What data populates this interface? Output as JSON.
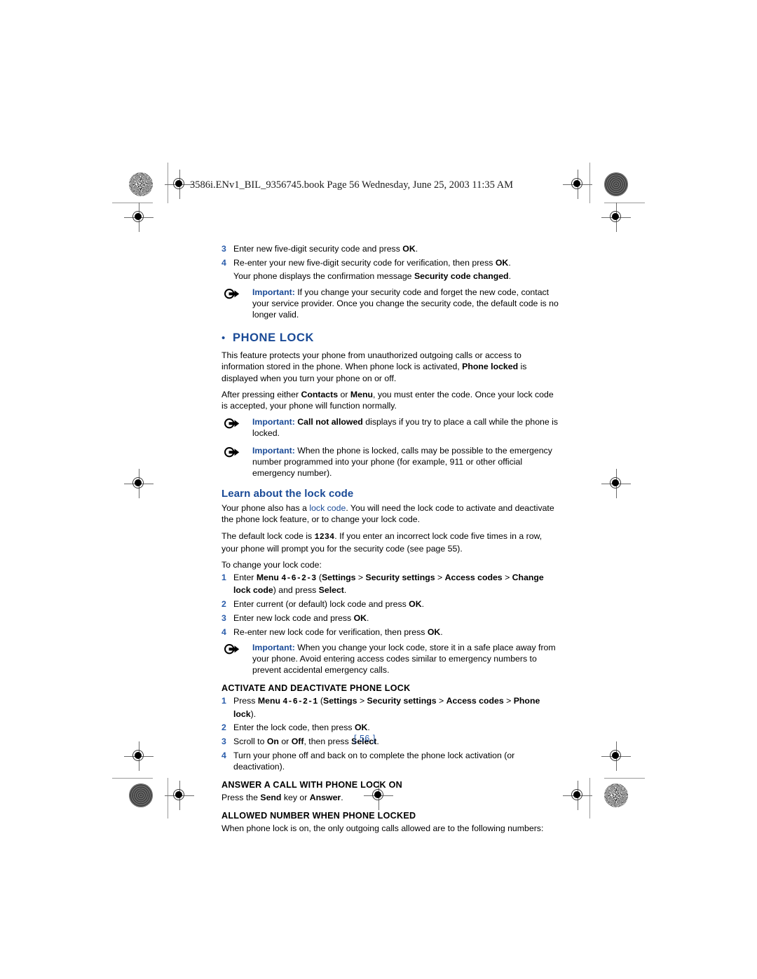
{
  "document": {
    "book_header": "3586i.ENv1_BIL_9356745.book  Page 56  Wednesday, June 25, 2003  11:35 AM",
    "page_number": "[ 56 ]"
  },
  "colors": {
    "heading_blue": "#1a4a96",
    "step_number_blue": "#2a5caa",
    "body_black": "#000000"
  },
  "top_steps": [
    {
      "num": "3",
      "text_pre": "Enter new five-digit security code and press ",
      "bold": "OK",
      "text_post": "."
    },
    {
      "num": "4",
      "text_pre": "Re-enter your new five-digit security code for verification, then press ",
      "bold": "OK",
      "text_post": "."
    }
  ],
  "top_steps_followup": {
    "text_pre": "Your phone displays the confirmation message ",
    "bold": "Security code changed",
    "text_post": "."
  },
  "important_1": {
    "label": "Important:",
    "text": " If you change your security code and forget the new code, contact your service provider. Once you change the security code, the default code is no longer valid.",
    "icon": "important-arrow-icon"
  },
  "phone_lock": {
    "bullet": "•",
    "heading": "PHONE LOCK",
    "para_1_a": "This feature protects your phone from unauthorized outgoing calls or access to information stored in the phone. When phone lock is activated, ",
    "para_1_bold": "Phone locked",
    "para_1_b": " is displayed when you turn your phone on or off.",
    "para_2_a": "After pressing either ",
    "para_2_bold_1": "Contacts",
    "para_2_b": " or ",
    "para_2_bold_2": "Menu",
    "para_2_c": ", you must enter the code. Once your lock code is accepted, your phone will function normally."
  },
  "important_2": {
    "label": "Important:",
    "text_a": " ",
    "bold": "Call not allowed",
    "text_b": " displays if you try to place a call while the phone is locked.",
    "icon": "important-arrow-icon"
  },
  "important_3": {
    "label": "Important:",
    "text": " When the phone is locked, calls may be possible to the emergency number programmed into your phone (for example, 911 or other official emergency number).",
    "icon": "important-arrow-icon"
  },
  "lock_code": {
    "heading": "Learn about the lock code",
    "para_1_a": "Your phone also has a ",
    "para_1_link": "lock code",
    "para_1_b": ". You will need the lock code to activate and deactivate the phone lock feature, or to change your lock code.",
    "para_2_a": "The default lock code is ",
    "para_2_mono": "1234",
    "para_2_b": ". If you enter an incorrect lock code five times in a row, your phone will prompt you for the security code (see page 55).",
    "para_3": "To change your lock code:",
    "steps": [
      {
        "num": "1",
        "pre": "Enter ",
        "menu_bold": "Menu ",
        "menu_mono": "4-6-2-3",
        "mid": " (",
        "b1": "Settings",
        "sep1": " > ",
        "b2": "Security settings",
        "sep2": " > ",
        "b3": "Access codes",
        "sep3": " > ",
        "b4": "Change lock code",
        "post": ") and press ",
        "b5": "Select",
        "end": "."
      },
      {
        "num": "2",
        "pre": "Enter current (or default) lock code and press ",
        "b1": "OK",
        "end": "."
      },
      {
        "num": "3",
        "pre": "Enter new lock code and press ",
        "b1": "OK",
        "end": "."
      },
      {
        "num": "4",
        "pre": "Re-enter new lock code for verification, then press ",
        "b1": "OK",
        "end": "."
      }
    ]
  },
  "important_4": {
    "label": "Important:",
    "text": " When you change your lock code, store it in a safe place away from your phone. Avoid entering access codes similar to emergency numbers to prevent accidental emergency calls.",
    "icon": "important-arrow-icon"
  },
  "activate_section": {
    "heading": "ACTIVATE AND DEACTIVATE PHONE LOCK",
    "steps": [
      {
        "num": "1",
        "pre": "Press ",
        "menu_bold": "Menu ",
        "menu_mono": "4-6-2-1",
        "mid": " (",
        "b1": "Settings",
        "sep1": " > ",
        "b2": "Security settings",
        "sep2": " > ",
        "b3": "Access codes",
        "sep3": " > ",
        "b4": "Phone lock",
        "post": ")."
      },
      {
        "num": "2",
        "pre": "Enter the lock code, then press ",
        "b1": "OK",
        "end": "."
      },
      {
        "num": "3",
        "pre": "Scroll to ",
        "b1": "On",
        "mid": " or ",
        "b2": "Off",
        "post": ", then press ",
        "b3": "Select",
        "end": "."
      },
      {
        "num": "4",
        "pre": "Turn your phone off and back on to complete the phone lock activation (or deactivation)."
      }
    ]
  },
  "answer_section": {
    "heading": "ANSWER A CALL WITH PHONE LOCK ON",
    "pre": "Press the ",
    "b1": "Send",
    "mid": " key or ",
    "b2": "Answer",
    "end": "."
  },
  "allowed_section": {
    "heading": "ALLOWED NUMBER WHEN PHONE LOCKED",
    "para": "When phone lock is on, the only outgoing calls allowed are to the following numbers:"
  }
}
